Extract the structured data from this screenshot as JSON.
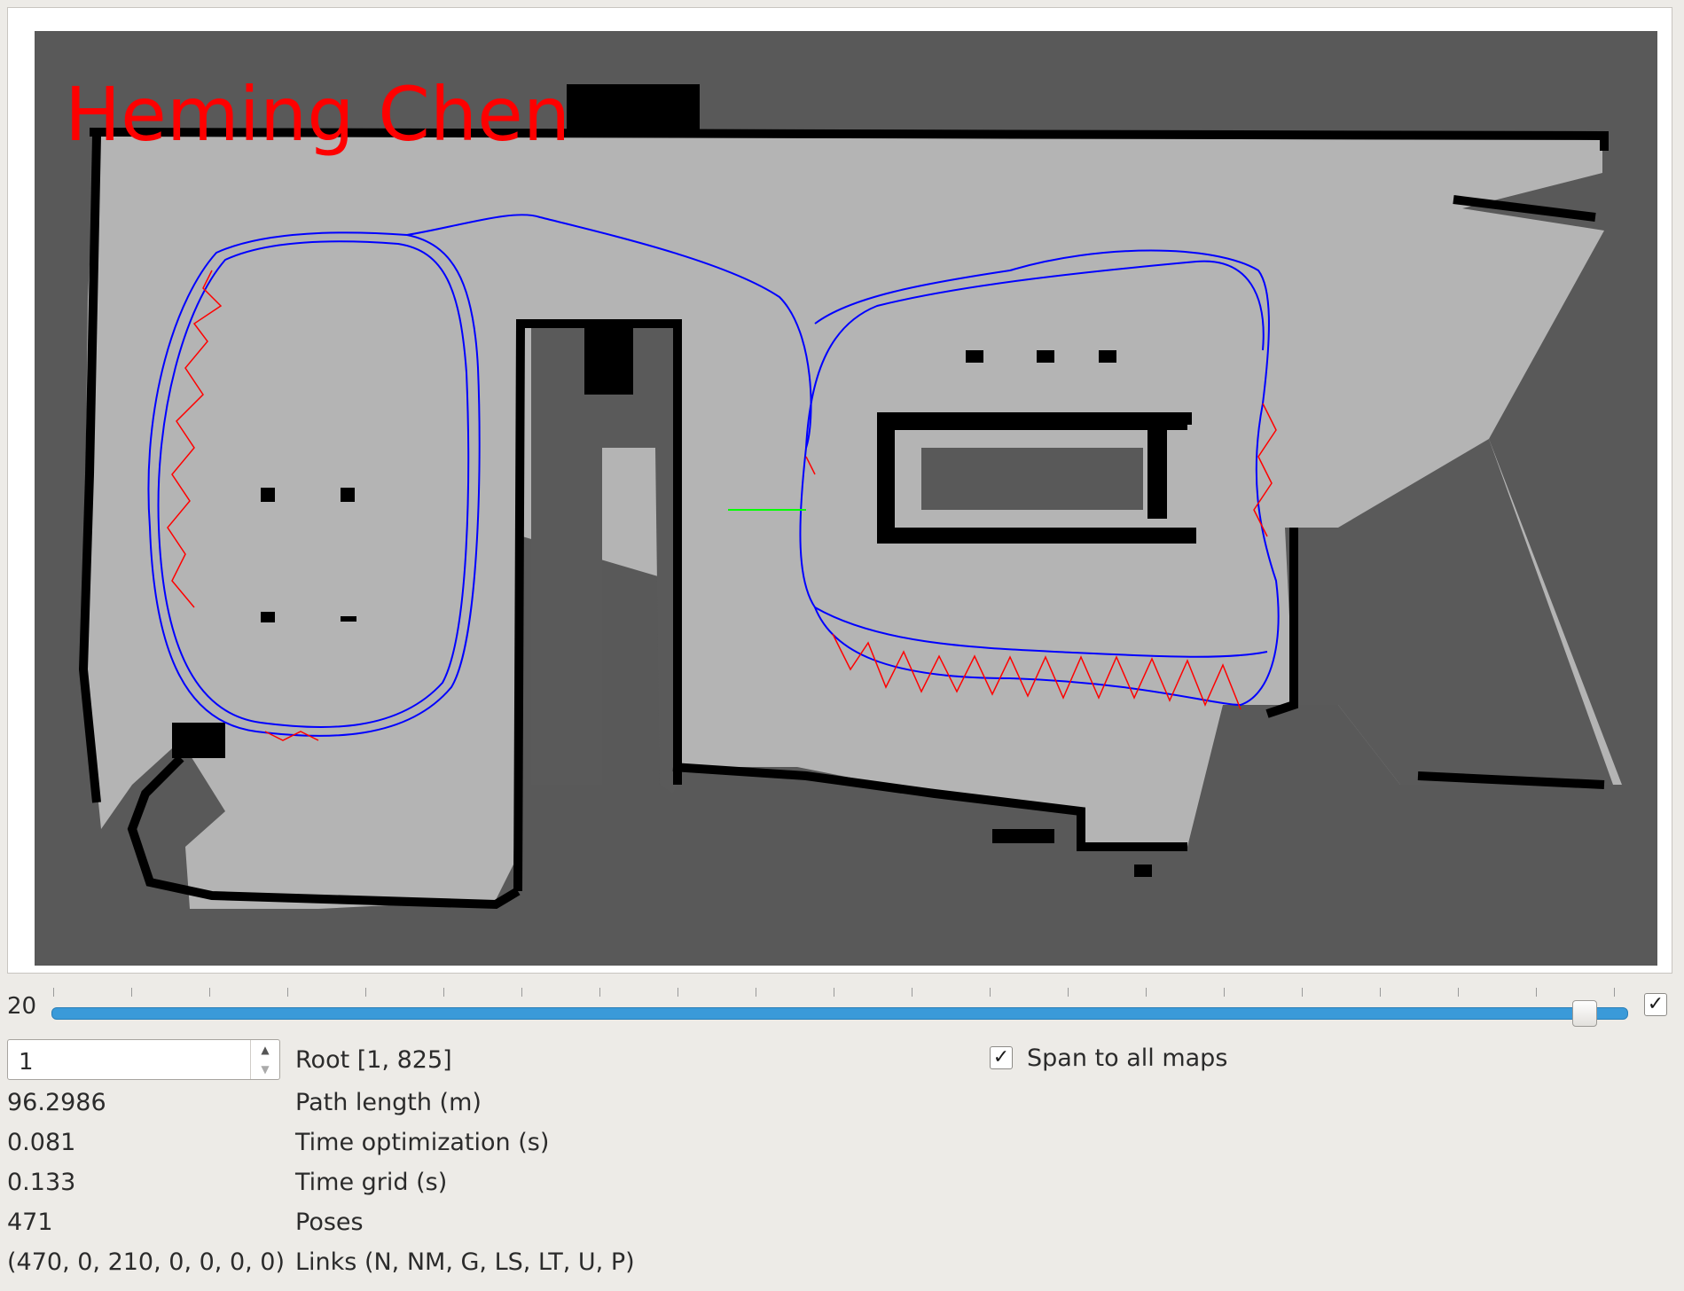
{
  "map": {
    "watermark": "Heming Chen",
    "colors": {
      "unknown": "#595959",
      "free": "#b4b4b4",
      "obstacle": "#000000",
      "trajectory": "#0000ff",
      "loop_links": "#ff0000",
      "current_pose_axis": "#00ff00"
    }
  },
  "slider": {
    "value": "20",
    "level": 0.98,
    "check": "✓"
  },
  "root": {
    "spin_value": "1",
    "label": "Root [1, 825]"
  },
  "span": {
    "check": "✓",
    "label": "Span to all maps"
  },
  "stats": [
    {
      "value": "96.2986",
      "label": "Path length (m)"
    },
    {
      "value": "0.081",
      "label": "Time optimization (s)"
    },
    {
      "value": "0.133",
      "label": "Time grid (s)"
    },
    {
      "value": "471",
      "label": "Poses"
    },
    {
      "value": "(470, 0, 210, 0, 0, 0, 0)",
      "label": "Links (N, NM, G, LS, LT, U, P)"
    }
  ]
}
